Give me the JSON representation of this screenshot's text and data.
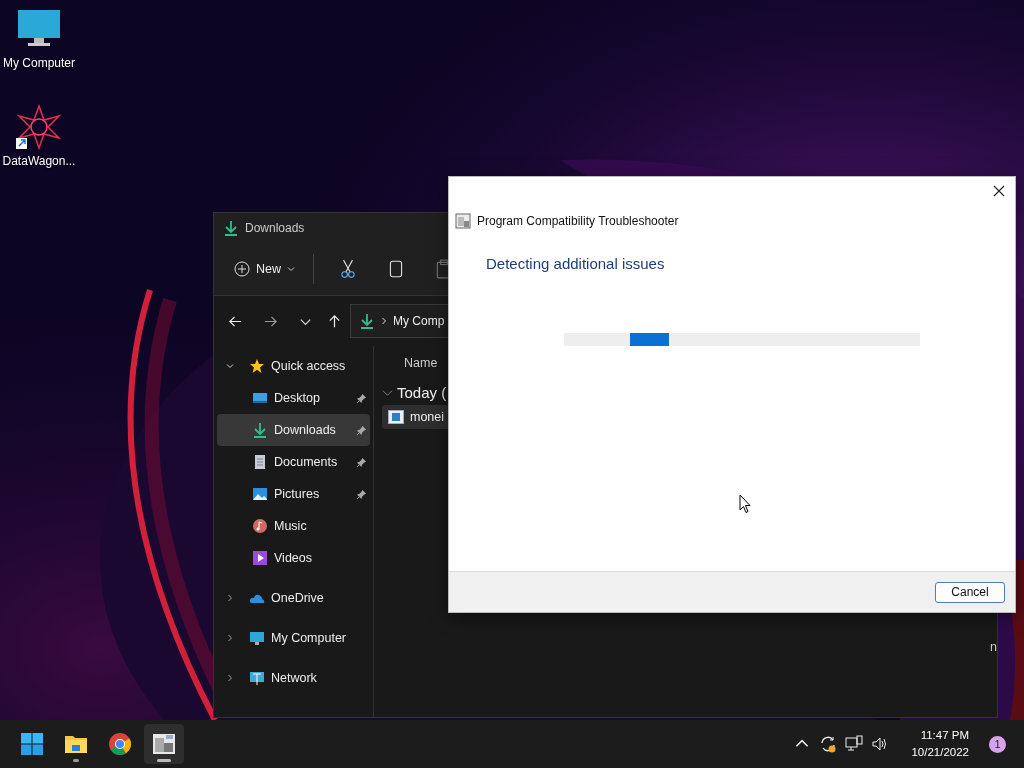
{
  "desktop_icons": [
    {
      "label": "My Computer",
      "kind": "monitor"
    },
    {
      "label": "DataWagon...",
      "kind": "shortcut"
    }
  ],
  "explorer": {
    "title": "Downloads",
    "new_label": "New",
    "address": "My Comp",
    "sidebar": [
      {
        "label": "Quick access",
        "kind": "star",
        "expanded": true,
        "selected": false,
        "children": [
          {
            "label": "Desktop",
            "kind": "desktop",
            "pinned": true,
            "selected": false
          },
          {
            "label": "Downloads",
            "kind": "download",
            "pinned": true,
            "selected": true
          },
          {
            "label": "Documents",
            "kind": "document",
            "pinned": true,
            "selected": false
          },
          {
            "label": "Pictures",
            "kind": "pictures",
            "pinned": true,
            "selected": false
          },
          {
            "label": "Music",
            "kind": "music",
            "pinned": false,
            "selected": false
          },
          {
            "label": "Videos",
            "kind": "videos",
            "pinned": false,
            "selected": false
          }
        ]
      },
      {
        "label": "OneDrive",
        "kind": "cloud",
        "expanded": false,
        "selected": false
      },
      {
        "label": "My Computer",
        "kind": "monitor",
        "expanded": false,
        "selected": false
      },
      {
        "label": "Network",
        "kind": "network",
        "expanded": false,
        "selected": false
      }
    ],
    "column_header": "Name",
    "group": "Today (",
    "files": [
      {
        "name": "monei",
        "selected": true
      }
    ],
    "column_text": "n"
  },
  "dialog": {
    "title": "Program Compatibility Troubleshooter",
    "heading": "Detecting additional issues",
    "progress_indeterminate": true,
    "buttons": [
      "Cancel"
    ]
  },
  "taskbar": {
    "apps": [
      {
        "kind": "start",
        "running": false,
        "active": false
      },
      {
        "kind": "folder",
        "running": true,
        "active": false
      },
      {
        "kind": "browser",
        "running": false,
        "active": false
      },
      {
        "kind": "troubleshooter",
        "running": true,
        "active": true
      }
    ],
    "time": "11:47 PM",
    "date": "10/21/2022",
    "notification_count": "1"
  }
}
